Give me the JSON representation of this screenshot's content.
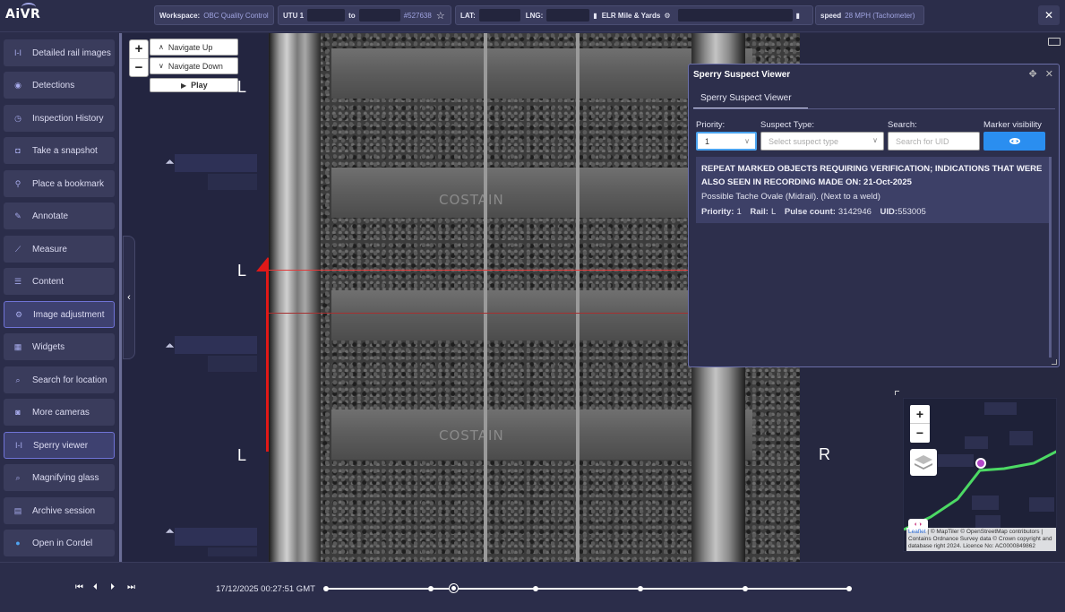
{
  "app": {
    "logo": "AiVR"
  },
  "topbar": {
    "workspace_label": "Workspace:",
    "workspace_value": "OBC Quality Control",
    "utu_label": "UTU 1",
    "to_label": "to",
    "utu_ref": "#527638",
    "lat_label": "LAT:",
    "lng_label": "LNG:",
    "elr_label": "ELR Mile & Yards",
    "speed_label": "speed",
    "speed_value": "28 MPH (Tachometer)",
    "close": "✕"
  },
  "sidebar": {
    "items": [
      {
        "label": "Detailed rail images",
        "icon": "rail-icon"
      },
      {
        "label": "Detections",
        "icon": "detections-icon"
      },
      {
        "label": "Inspection History",
        "icon": "history-icon"
      },
      {
        "label": "Take a snapshot",
        "icon": "camera-icon"
      },
      {
        "label": "Place a bookmark",
        "icon": "pin-icon"
      },
      {
        "label": "Annotate",
        "icon": "annotate-icon"
      },
      {
        "label": "Measure",
        "icon": "ruler-icon"
      },
      {
        "label": "Content",
        "icon": "list-icon"
      },
      {
        "label": "Image adjustment",
        "icon": "gear-icon"
      },
      {
        "label": "Widgets",
        "icon": "widgets-icon"
      },
      {
        "label": "Search for location",
        "icon": "search-icon"
      },
      {
        "label": "More cameras",
        "icon": "cameras-icon"
      },
      {
        "label": "Sperry viewer",
        "icon": "rail-icon"
      },
      {
        "label": "Magnifying glass",
        "icon": "magnifier-icon"
      },
      {
        "label": "Archive session",
        "icon": "archive-icon"
      },
      {
        "label": "Open in Cordel",
        "icon": "globe-icon"
      }
    ]
  },
  "viewer": {
    "navigate_up": "Navigate Up",
    "navigate_down": "Navigate Down",
    "play": "Play",
    "zoom_in": "+",
    "zoom_out": "−",
    "side_left": "L",
    "side_right": "R",
    "sleeper_text": "COSTAIN"
  },
  "sperry": {
    "title": "Sperry Suspect Viewer",
    "tab": "Sperry Suspect Viewer",
    "priority_label": "Priority:",
    "priority_value": "1",
    "type_label": "Suspect Type:",
    "type_placeholder": "Select suspect type",
    "search_label": "Search:",
    "search_placeholder": "Search for UID",
    "marker_label": "Marker visibility",
    "result": {
      "heading": "REPEAT MARKED OBJECTS REQUIRING VERIFICATION; INDICATIONS THAT WERE ALSO SEEN IN RECORDING MADE ON: 21-Oct-2025",
      "description": "Possible Tache Ovale (Midrail). (Next to a weld)",
      "priority_label": "Priority:",
      "priority": "1",
      "rail_label": "Rail:",
      "rail": "L",
      "pulse_label": "Pulse count:",
      "pulse": "3142946",
      "uid_label": "UID:",
      "uid": "553005"
    }
  },
  "map": {
    "zoom_in": "+",
    "zoom_out": "−",
    "attribution_leaflet": "Leaflet",
    "attribution_text": "| © MapTiler © OpenStreetMap contributors | Contains Ordnance Survey data © Crown copyright and database right 2024. Licence No: AC0000849862"
  },
  "playback": {
    "timestamp": "17/12/2025  00:27:51  GMT",
    "progress": 0.245
  },
  "colors": {
    "background": "#2b2d4a",
    "accent": "#2a8ef0",
    "red_marker": "#e01818",
    "route": "#4cd964"
  }
}
